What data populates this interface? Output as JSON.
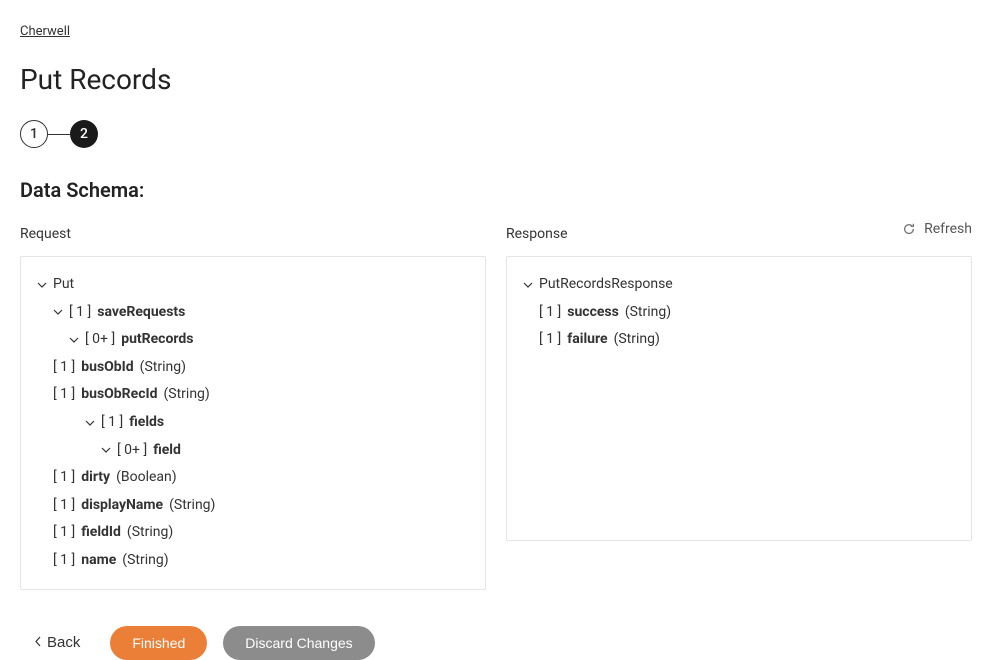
{
  "breadcrumb": "Cherwell",
  "pageTitle": "Put Records",
  "stepper": {
    "step1": "1",
    "step2": "2"
  },
  "sectionTitle": "Data Schema:",
  "requestLabel": "Request",
  "responseLabel": "Response",
  "refreshLabel": "Refresh",
  "request": {
    "root": {
      "name": "Put"
    },
    "saveRequests": {
      "card": "[ 1 ]",
      "name": "saveRequests"
    },
    "putRecords": {
      "card": "[ 0+ ]",
      "name": "putRecords"
    },
    "busObId": {
      "card": "[ 1 ]",
      "name": "busObId",
      "type": "(String)"
    },
    "busObRecId": {
      "card": "[ 1 ]",
      "name": "busObRecId",
      "type": "(String)"
    },
    "fields": {
      "card": "[ 1 ]",
      "name": "fields"
    },
    "field": {
      "card": "[ 0+ ]",
      "name": "field"
    },
    "dirty": {
      "card": "[ 1 ]",
      "name": "dirty",
      "type": "(Boolean)"
    },
    "displayName": {
      "card": "[ 1 ]",
      "name": "displayName",
      "type": "(String)"
    },
    "fieldId": {
      "card": "[ 1 ]",
      "name": "fieldId",
      "type": "(String)"
    },
    "name": {
      "card": "[ 1 ]",
      "name": "name",
      "type": "(String)"
    }
  },
  "response": {
    "root": {
      "name": "PutRecordsResponse"
    },
    "success": {
      "card": "[ 1 ]",
      "name": "success",
      "type": "(String)"
    },
    "failure": {
      "card": "[ 1 ]",
      "name": "failure",
      "type": "(String)"
    }
  },
  "footer": {
    "back": "Back",
    "finished": "Finished",
    "discard": "Discard Changes"
  }
}
